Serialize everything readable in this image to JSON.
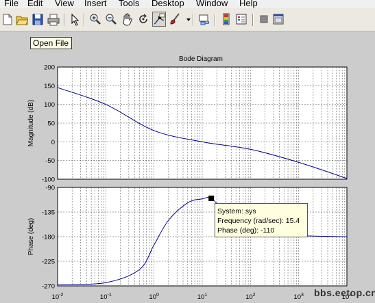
{
  "menu": [
    "File",
    "Edit",
    "View",
    "Insert",
    "Tools",
    "Desktop",
    "Window",
    "Help"
  ],
  "toolbar": {
    "buttons": [
      {
        "name": "new-figure-icon"
      },
      {
        "name": "open-file-icon"
      },
      {
        "name": "save-figure-icon"
      },
      {
        "name": "print-figure-icon"
      },
      {
        "name": "edit-plot-arrow-icon"
      },
      {
        "name": "zoom-in-icon"
      },
      {
        "name": "zoom-out-icon"
      },
      {
        "name": "pan-hand-icon"
      },
      {
        "name": "rotate-3d-icon"
      },
      {
        "name": "data-cursor-icon"
      },
      {
        "name": "brush-icon"
      },
      {
        "name": "link-plot-icon"
      },
      {
        "name": "colorbar-icon"
      },
      {
        "name": "legend-icon"
      },
      {
        "name": "hide-plot-tools-icon"
      },
      {
        "name": "show-plot-tools-icon"
      }
    ],
    "tooltip": "Open File"
  },
  "chart_data": {
    "type": "line",
    "title": "Bode Diagram",
    "x": [
      0.01,
      0.1,
      1,
      10,
      100,
      1000,
      10000
    ],
    "xticks": [
      "10-2",
      "10-1",
      "100",
      "101",
      "102",
      "103",
      "104"
    ],
    "xlabel": "",
    "xscale": "log",
    "grid": true,
    "magnitude": {
      "ylabel": "Magnitude (dB)",
      "ylim": [
        -100,
        200
      ],
      "yticks": [
        -100,
        -50,
        0,
        50,
        100,
        150,
        200
      ],
      "x": [
        0.01,
        0.1,
        1,
        10,
        100,
        1000,
        10000
      ],
      "values": [
        145,
        100,
        30,
        0,
        -20,
        -55,
        -98
      ]
    },
    "phase": {
      "ylabel": "Phase (deg)",
      "ylim": [
        -270,
        -90
      ],
      "yticks": [
        -270,
        -225,
        -180,
        -135,
        -90
      ],
      "x": [
        0.01,
        0.1,
        0.5,
        1,
        2,
        5,
        10,
        15.4,
        30,
        100,
        1000,
        10000
      ],
      "values": [
        -268,
        -264,
        -240,
        -195,
        -150,
        -118,
        -111,
        -110,
        -135,
        -170,
        -178,
        -180
      ]
    },
    "datatip": {
      "line1": "System: sys",
      "line2": "Frequency (rad/sec): 15.4",
      "line3": "Phase (deg): -110"
    }
  },
  "watermark": "bbs.eetop.cn"
}
